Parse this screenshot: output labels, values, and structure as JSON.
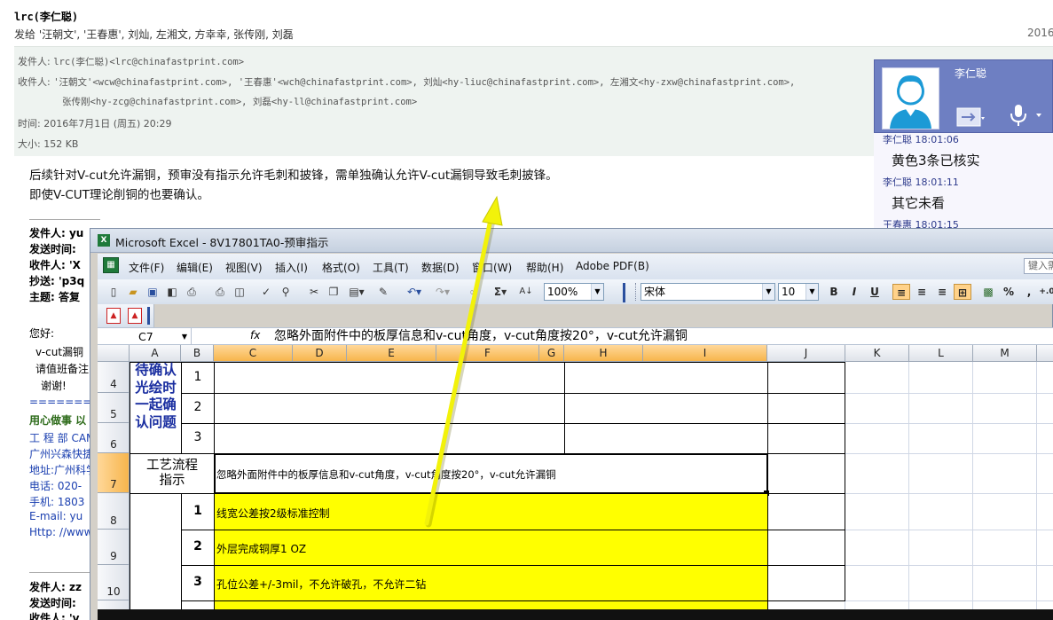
{
  "email": {
    "subject": "lrc(李仁聪)",
    "send_to_line": "发给 '汪朝文', '王春惠', 刘灿, 左湘文, 方幸幸, 张传刚, 刘磊",
    "date_partial": "2016",
    "header": {
      "from_label": "发件人:",
      "from_value": "lrc(李仁聪)<lrc@chinafastprint.com>",
      "to_label": "收件人:",
      "to_value_1": "'汪朝文'<wcw@chinafastprint.com>,  '王春惠'<wch@chinafastprint.com>,  刘灿<hy-liuc@chinafastprint.com>,  左湘文<hy-zxw@chinafastprint.com>,",
      "to_value_2": "张传刚<hy-zcg@chinafastprint.com>,  刘磊<hy-ll@chinafastprint.com>",
      "time_label": "时间:",
      "time_value": "2016年7月1日 (周五) 20:29",
      "size_label": "大小:",
      "size_value": "152 KB"
    },
    "body_line_1": "后续针对V-cut允许漏铜，预审没有指示允许毛刺和披锋，需单独确认允许V-cut漏铜导致毛刺披锋。",
    "body_line_2": "即使V-CUT理论削铜的也要确认。",
    "quoted": {
      "from": "发件人: yu",
      "sent": "发送时间: ",
      "to": "收件人: 'X",
      "cc": "抄送: 'p3q",
      "subject": "主题: 答复",
      "greeting": "您好:",
      "line1": "v-cut漏铜",
      "line2": "请值班备注",
      "line3": "谢谢!",
      "sep": "==========",
      "sig1": "用心做事 以",
      "sig2": "工 程 部  CAM",
      "sig3": "广州兴森快捷",
      "sig4": "地址:广州科学",
      "sig5": "电话: 020-",
      "sig6": "手机: 1803",
      "sig7": "E-mail: yu",
      "sig8": "Http: //www",
      "from2": "发件人: zz",
      "sent2": "发送时间: ",
      "to2": "收件人: 'v"
    }
  },
  "chat": {
    "contact_name": "李仁聪",
    "messages": [
      {
        "meta": "李仁聪 18:01:06",
        "text": "黄色3条已核实"
      },
      {
        "meta": "李仁聪 18:01:11",
        "text": "其它未看"
      },
      {
        "meta": "王春惠 18:01:15",
        "text": ""
      }
    ],
    "accent_color": "#6e7fc2"
  },
  "excel": {
    "title": "Microsoft Excel - 8V17801TA0-预审指示",
    "menu": [
      "文件(F)",
      "编辑(E)",
      "视图(V)",
      "插入(I)",
      "格式(O)",
      "工具(T)",
      "数据(D)",
      "窗口(W)",
      "帮助(H)",
      "Adobe PDF(B)"
    ],
    "help_placeholder": "键入需",
    "zoom": "100%",
    "font_name": "宋体",
    "font_size": "10",
    "name_box": "C7",
    "fx_label": "fx",
    "formula": "忽略外面附件中的板厚信息和v-cut角度，v-cut角度按20°，v-cut允许漏铜",
    "columns": [
      "A",
      "B",
      "C",
      "D",
      "E",
      "F",
      "G",
      "H",
      "I",
      "J",
      "K",
      "L",
      "M"
    ],
    "selected_column": "C",
    "rows": [
      "4",
      "5",
      "6",
      "7",
      "8",
      "9",
      "10"
    ],
    "selected_row": "7",
    "a_block_text": [
      "待确认",
      "光绘时",
      "一起确",
      "认问题"
    ],
    "b_numbers_top": [
      "1",
      "2",
      "3"
    ],
    "a7_text": [
      "工艺流程",
      "指示"
    ],
    "c7_text": "忽略外面附件中的板厚信息和v-cut角度，v-cut角度按20°，v-cut允许漏铜",
    "b_numbers_bottom": [
      "1",
      "2",
      "3"
    ],
    "yellow_rows": [
      "线宽公差按2级标准控制",
      "外层完成铜厚1 OZ",
      "孔位公差+/-3mil，不允许破孔，不允许二钻"
    ],
    "highlight_color": "#ffff00"
  },
  "annotation": {
    "arrow_color": "#f2f20a"
  }
}
